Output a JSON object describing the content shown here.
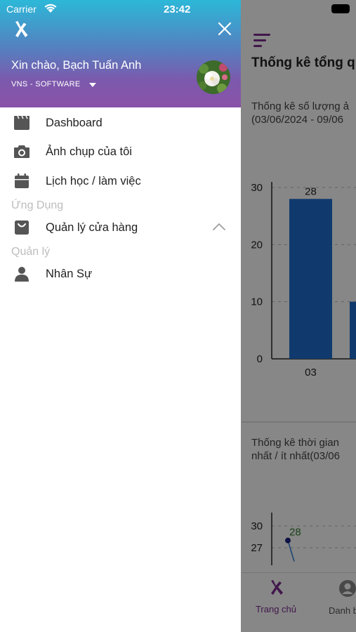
{
  "status_bar": {
    "carrier": "Carrier",
    "time": "23:42"
  },
  "drawer": {
    "greeting": "Xin chào, Bạch Tuấn Anh",
    "company": "VNS - SOFTWARE",
    "menu": [
      {
        "label": "Dashboard",
        "icon": "dashboard-icon"
      },
      {
        "label": "Ảnh chụp của tôi",
        "icon": "camera-icon"
      },
      {
        "label": "Lịch học / làm việc",
        "icon": "calendar-icon"
      }
    ],
    "sections": [
      {
        "title": "Ứng Dụng",
        "items": [
          {
            "label": "Quản lý cửa hàng",
            "icon": "shopping-bag-icon",
            "expanded": true
          }
        ]
      },
      {
        "title": "Quản lý",
        "items": [
          {
            "label": "Nhân Sự",
            "icon": "person-icon"
          }
        ]
      }
    ]
  },
  "background": {
    "title": "Thống kê tổng q",
    "card1": {
      "line1": "Thống kê số lượng ả",
      "line2": "(03/06/2024 - 09/06"
    },
    "card2": {
      "line1": "Thống kê thời gian",
      "line2": "nhất / ít nhất(03/06"
    },
    "tabs": [
      {
        "label": "Trang chủ",
        "icon": "home-logo-icon",
        "active": true
      },
      {
        "label": "Danh b",
        "icon": "contacts-icon",
        "active": false
      }
    ]
  },
  "chart_data": [
    {
      "type": "bar",
      "categories": [
        "03",
        ""
      ],
      "values": [
        28,
        10
      ],
      "data_labels": [
        "28",
        ""
      ],
      "ylim": [
        0,
        30
      ],
      "yticks": [
        0,
        10,
        20,
        30
      ],
      "bar_color": "#1f6fd0"
    },
    {
      "type": "line",
      "points": [
        {
          "y": 28
        }
      ],
      "data_labels": [
        "28"
      ],
      "yticks": [
        27,
        30
      ],
      "line_color": "#4a90e2",
      "label_color": "#2e7d32"
    }
  ],
  "colors": {
    "accent": "#7b2d8e",
    "drawer_text": "#222222",
    "section_text": "#bdbdbd",
    "icon": "#555555"
  }
}
